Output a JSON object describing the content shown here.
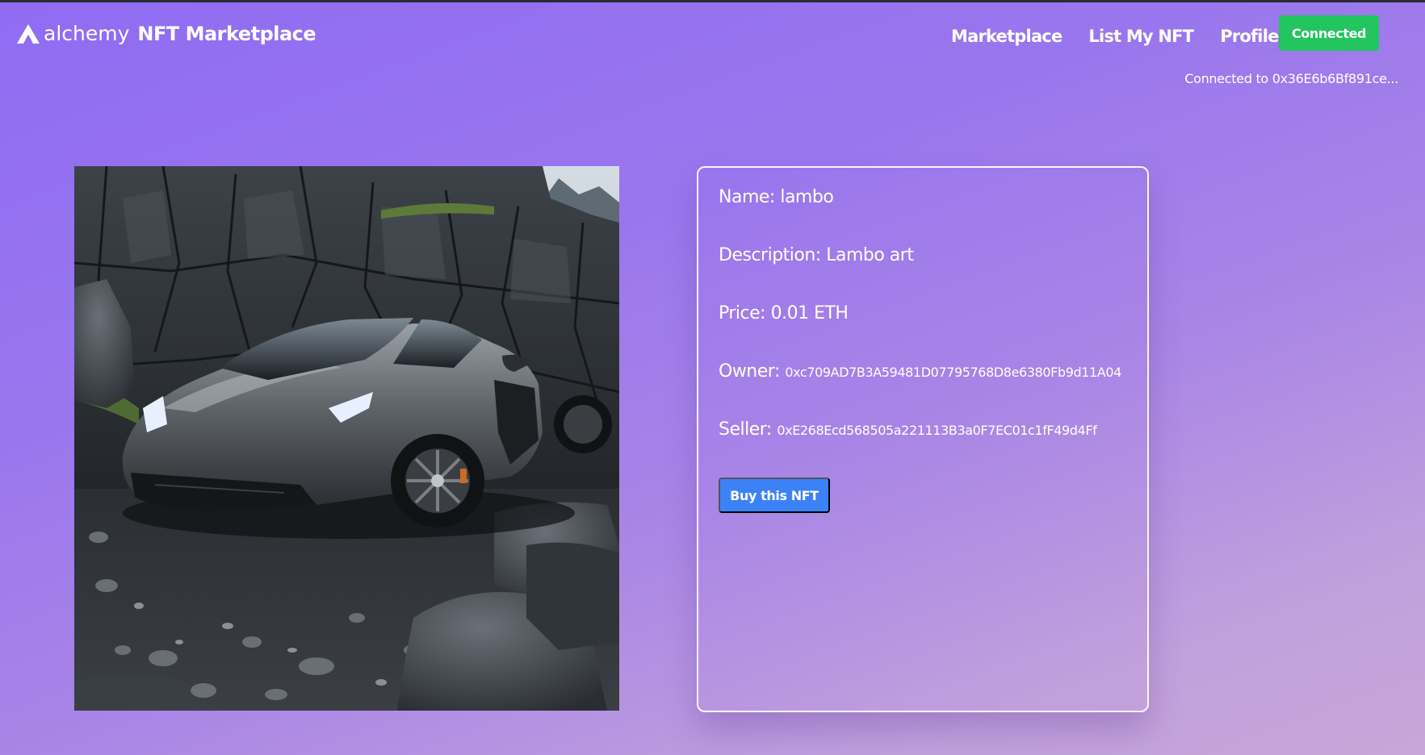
{
  "header": {
    "logo_word": "alchemy",
    "app_title": "NFT Marketplace",
    "nav": [
      {
        "label": "Marketplace"
      },
      {
        "label": "List My NFT"
      },
      {
        "label": "Profile"
      }
    ],
    "connect_label": "Connected",
    "wallet_status": "Connected to 0x36E6b6Bf891ce..."
  },
  "nft": {
    "image_subject": "lamborghini-photo",
    "name_label": "Name:",
    "name": "lambo",
    "description_label": "Description:",
    "description": "Lambo art",
    "price_label": "Price:",
    "price": "0.01 ETH",
    "owner_label": "Owner:",
    "owner": "0xc709AD7B3A59481D07795768D8e6380Fb9d11A04",
    "seller_label": "Seller:",
    "seller": "0xE268Ecd568505a221113B3a0F7EC01c1fF49d4Ff",
    "buy_label": "Buy this NFT"
  },
  "colors": {
    "connected_green": "#22c55e",
    "buy_blue": "#3b82f6",
    "gradient_top": "#8f6cf2",
    "gradient_bottom": "#c8a6d8"
  }
}
